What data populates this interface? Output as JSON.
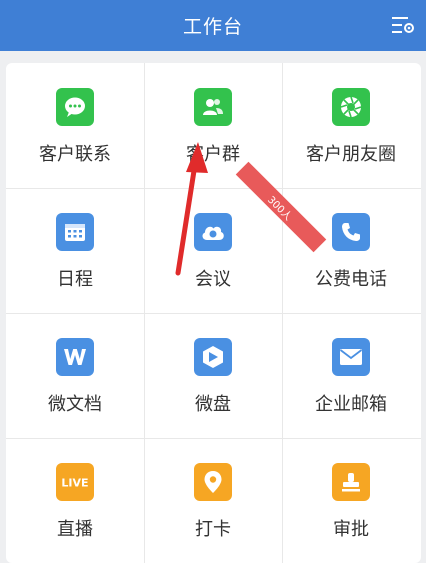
{
  "header": {
    "title": "工作台",
    "settings_icon": "settings-list-icon"
  },
  "colors": {
    "header_bg": "#3f7fd5",
    "green": "#33c24d",
    "blue": "#4a90e2",
    "orange": "#f6a623",
    "ribbon": "#e85a5a",
    "arrow": "#e02b2b"
  },
  "grid": {
    "items": [
      {
        "label": "客户联系",
        "icon": "chat-bubble-icon"
      },
      {
        "label": "客户群",
        "icon": "group-icon"
      },
      {
        "label": "客户朋友圈",
        "icon": "aperture-icon"
      },
      {
        "label": "日程",
        "icon": "calendar-icon"
      },
      {
        "label": "会议",
        "icon": "cloud-meeting-icon"
      },
      {
        "label": "公费电话",
        "icon": "phone-icon"
      },
      {
        "label": "微文档",
        "icon": "document-w-icon"
      },
      {
        "label": "微盘",
        "icon": "drive-icon"
      },
      {
        "label": "企业邮箱",
        "icon": "mail-icon"
      },
      {
        "label": "直播",
        "icon": "live-icon"
      },
      {
        "label": "打卡",
        "icon": "location-pin-icon"
      },
      {
        "label": "审批",
        "icon": "stamp-icon"
      }
    ]
  },
  "ribbon": {
    "text": "300人"
  }
}
